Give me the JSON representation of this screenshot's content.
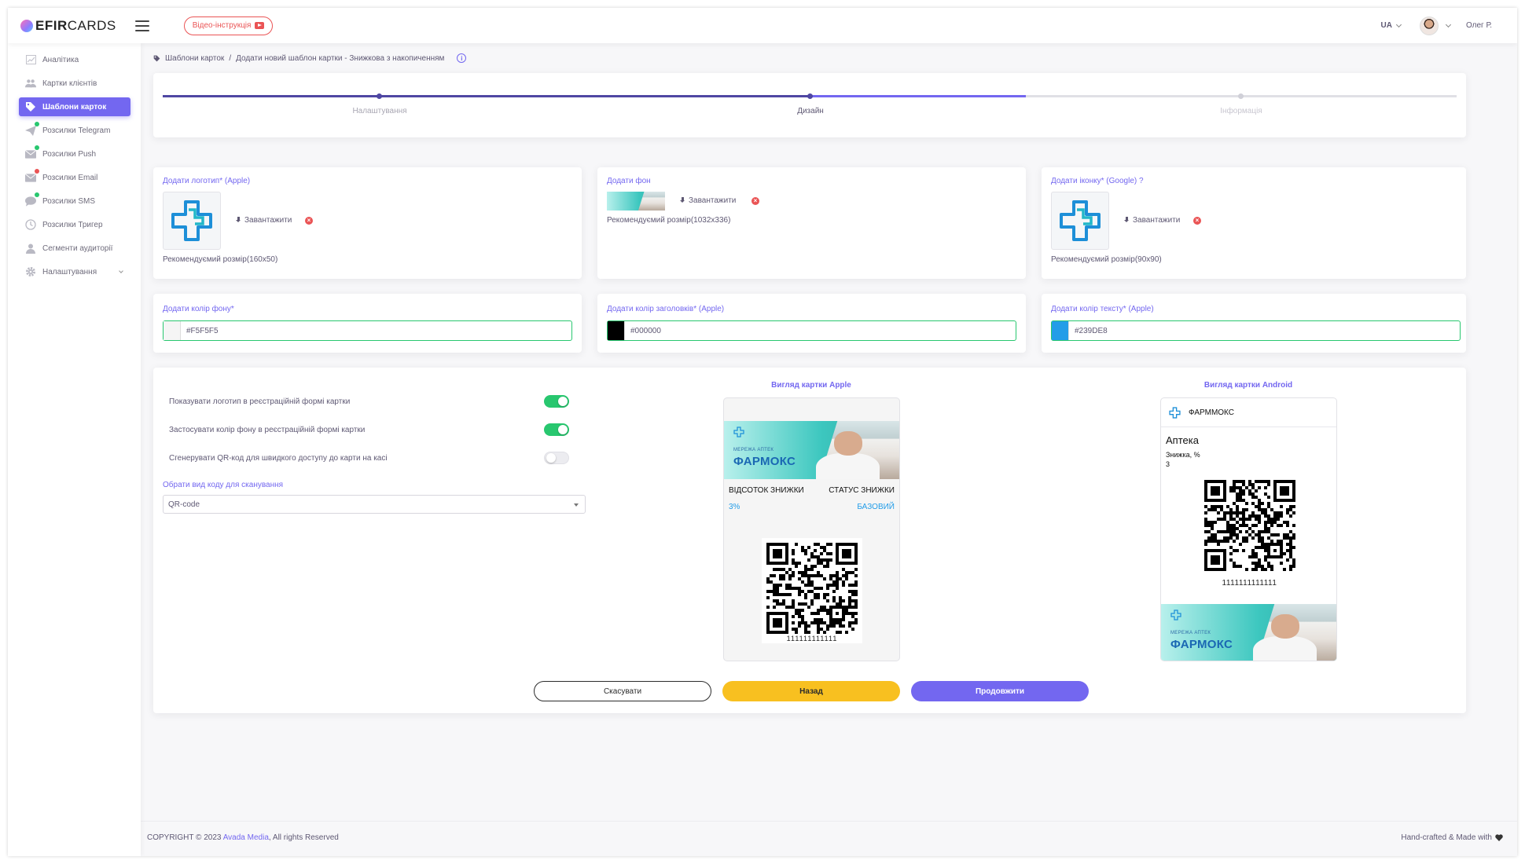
{
  "app": {
    "logo_bold": "EFIR",
    "logo_light": "CARDS",
    "video_btn_label": "Відео-інструкція"
  },
  "header": {
    "lang": "UA",
    "user_name": "Олег Р."
  },
  "sidebar": {
    "items": [
      {
        "label": "Аналітика",
        "icon": "chart-icon"
      },
      {
        "label": "Картки клієнтів",
        "icon": "users-icon"
      },
      {
        "label": "Шаблони карток",
        "icon": "tag-icon"
      },
      {
        "label": "Розсилки Telegram",
        "icon": "telegram-icon"
      },
      {
        "label": "Розсилки Push",
        "icon": "mail-icon"
      },
      {
        "label": "Розсилки Email",
        "icon": "mail-icon"
      },
      {
        "label": "Розсилки SMS",
        "icon": "chat-icon"
      },
      {
        "label": "Розсилки Тригер",
        "icon": "clock-icon"
      },
      {
        "label": "Сегменти аудиторії",
        "icon": "user-icon"
      },
      {
        "label": "Налаштування",
        "icon": "gear-icon"
      }
    ],
    "badge_colors": {
      "green": "#28c76f",
      "red": "#ea5455"
    }
  },
  "breadcrumb": {
    "root": "Шаблони карток",
    "separator": "/",
    "current": "Додати новий шаблон картки - Знижкова з накопиченням",
    "info": "i"
  },
  "stepper": {
    "steps": [
      "Налаштування",
      "Дизайн",
      "Інформація"
    ],
    "active_step": 2,
    "accent": "#7367f0"
  },
  "images": {
    "logo": {
      "label": "Додати логотип* (Apple)",
      "upload": "Завантажити",
      "recommended": "Рекомендуємий розмір(160x50)"
    },
    "background": {
      "label": "Додати фон",
      "upload": "Завантажити",
      "recommended": "Рекомендуємий розмір(1032x336)"
    },
    "icon": {
      "label": "Додати іконку* (Google) ?",
      "upload": "Завантажити",
      "recommended": "Рекомендуємий розмір(90x90)"
    }
  },
  "colors": {
    "background": {
      "label": "Додати колір фону*",
      "value": "#F5F5F5"
    },
    "headers": {
      "label": "Додати колір заголовків* (Apple)",
      "value": "#000000"
    },
    "text": {
      "label": "Додати колір тексту* (Apple)",
      "value": "#239DE8"
    }
  },
  "options": {
    "show_logo": {
      "label": "Показувати логотип в реєстраційній формі картки",
      "on": true
    },
    "apply_bg": {
      "label": "Застосувати колір фону в реєстраційній формі картки",
      "on": true
    },
    "qr_code": {
      "label": "Сгенерувати QR-код для швидкого доступу до карти на касі",
      "on": false
    },
    "code_type_label": "Обрати вид коду для сканування",
    "code_type_value": "QR-code"
  },
  "apple_preview": {
    "title": "Вигляд картки Apple",
    "banner_network": "МЕРЕЖА АПТЕК",
    "banner_brand": "ФАРМОКС",
    "field1_label": "ВІДСОТОК ЗНИЖКИ",
    "field1_value": "3%",
    "field2_label": "СТАТУС ЗНИЖКИ",
    "field2_value": "БАЗОВИЙ",
    "barcode_text": "111111111111"
  },
  "android_preview": {
    "title": "Вигляд картки Android",
    "header_name": "ФАРММОКС",
    "card_title": "Аптека",
    "discount_label": "Знижка, %",
    "discount_value": "3",
    "barcode_text": "1111111111111",
    "banner_network": "МЕРЕЖА АПТЕК",
    "banner_brand": "ФАРМОКС"
  },
  "actions": {
    "cancel": "Скасувати",
    "back": "Назад",
    "continue": "Продовжити"
  },
  "footer": {
    "copyright": "COPYRIGHT © 2023",
    "company": "Avada Media",
    "rights": ", All rights Reserved",
    "made_with": "Hand-crafted & Made with"
  }
}
